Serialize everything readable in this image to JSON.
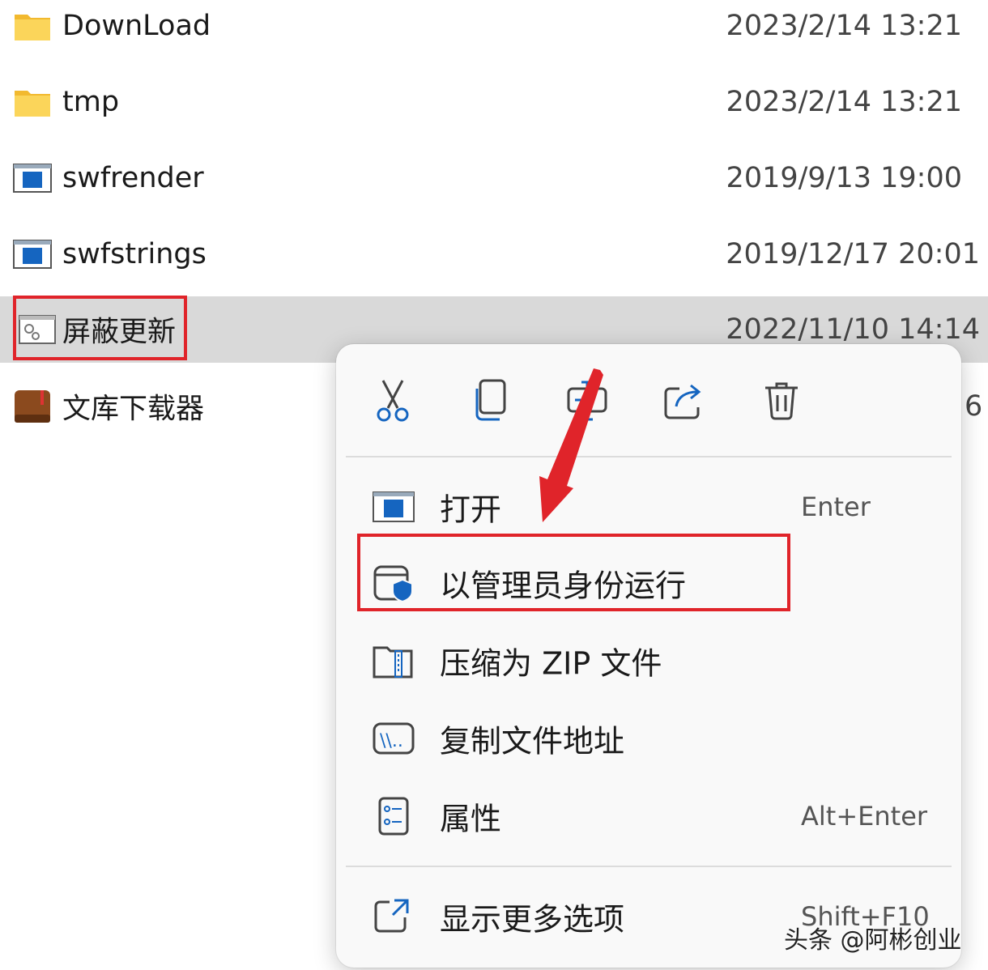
{
  "files": [
    {
      "name": "DownLoad",
      "date": "2023/2/14 13:21",
      "icon": "folder-icon"
    },
    {
      "name": "tmp",
      "date": "2023/2/14 13:21",
      "icon": "folder-icon"
    },
    {
      "name": "swfrender",
      "date": "2019/9/13 19:00",
      "icon": "app-window-icon"
    },
    {
      "name": "swfstrings",
      "date": "2019/12/17 20:01",
      "icon": "app-window-icon"
    },
    {
      "name": "屏蔽更新",
      "date": "2022/11/10 14:14",
      "icon": "settings-file-icon",
      "selected": true
    },
    {
      "name": "文库下载器",
      "date": "",
      "icon": "book-app-icon"
    }
  ],
  "partial_date_char": "6",
  "context_menu": {
    "toolbar": [
      {
        "name": "cut",
        "icon": "scissors-icon"
      },
      {
        "name": "copy",
        "icon": "copy-icon"
      },
      {
        "name": "rename",
        "icon": "rename-icon"
      },
      {
        "name": "share",
        "icon": "share-icon"
      },
      {
        "name": "delete",
        "icon": "trash-icon"
      }
    ],
    "items": [
      {
        "label": "打开",
        "shortcut": "Enter",
        "icon": "app-window-icon"
      },
      {
        "label": "以管理员身份运行",
        "shortcut": "",
        "icon": "admin-shield-icon"
      },
      {
        "label": "压缩为 ZIP 文件",
        "shortcut": "",
        "icon": "zip-folder-icon"
      },
      {
        "label": "复制文件地址",
        "shortcut": "",
        "icon": "path-copy-icon"
      },
      {
        "label": "属性",
        "shortcut": "Alt+Enter",
        "icon": "properties-icon"
      },
      {
        "label": "显示更多选项",
        "shortcut": "Shift+F10",
        "icon": "more-options-icon"
      }
    ]
  },
  "watermark": "头条 @阿彬创业",
  "colors": {
    "highlight": "#e0242a",
    "accent": "#0a6fd6",
    "folder": "#f7c843",
    "selected_row": "#d9d9d9"
  }
}
